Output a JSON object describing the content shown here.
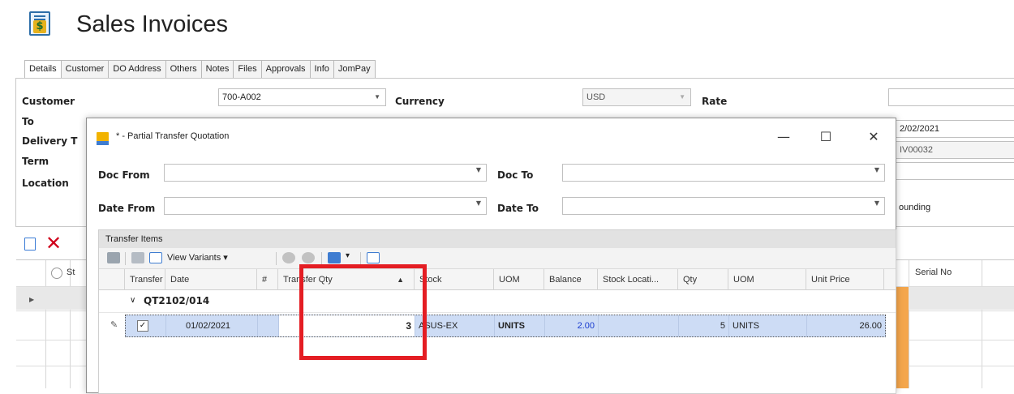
{
  "page": {
    "title": "Sales Invoices",
    "tabs": [
      "Details",
      "Customer",
      "DO Address",
      "Others",
      "Notes",
      "Files",
      "Approvals",
      "Info",
      "JomPay"
    ],
    "active_tab": "Details"
  },
  "main_form": {
    "labels": {
      "customer": "Customer",
      "to": "To",
      "delivery": "Delivery T",
      "term": "Term",
      "location": "Location",
      "currency": "Currency",
      "rate": "Rate"
    },
    "customer_value": "700-A002",
    "currency_value": "USD",
    "right_date": "2/02/2021",
    "right_docno": "IV00032",
    "right_rounding": "ounding"
  },
  "bottom_grid": {
    "header_partial": "St",
    "serial_header": "Serial No"
  },
  "dialog": {
    "title": "* - Partial Transfer Quotation",
    "minimize": "—",
    "maximize": "☐",
    "close": "✕",
    "labels": {
      "doc_from": "Doc From",
      "doc_to": "Doc To",
      "date_from": "Date From",
      "date_to": "Date To"
    },
    "group_title": "Transfer Items",
    "toolbar": {
      "view_variants": "View Variants"
    },
    "columns": [
      "Transfer",
      "Date",
      "#",
      "Transfer Qty",
      "Stock",
      "UOM",
      "Balance",
      "Stock Locati...",
      "Qty",
      "UOM",
      "Unit Price"
    ],
    "group_row_label": "QT2102/014",
    "row": {
      "transfer_checked": true,
      "date": "01/02/2021",
      "number": "",
      "transfer_qty": "3",
      "stock": "ASUS-EX",
      "uom": "UNITS",
      "balance": "2.00",
      "stock_location": "",
      "qty": "5",
      "uom2": "UNITS",
      "unit_price": "26.00"
    }
  },
  "colors": {
    "highlight": "#e41d23",
    "selected_row": "#cddcf5",
    "balance_text": "#1a3ccf",
    "orange_bar": "#f4a64c"
  }
}
